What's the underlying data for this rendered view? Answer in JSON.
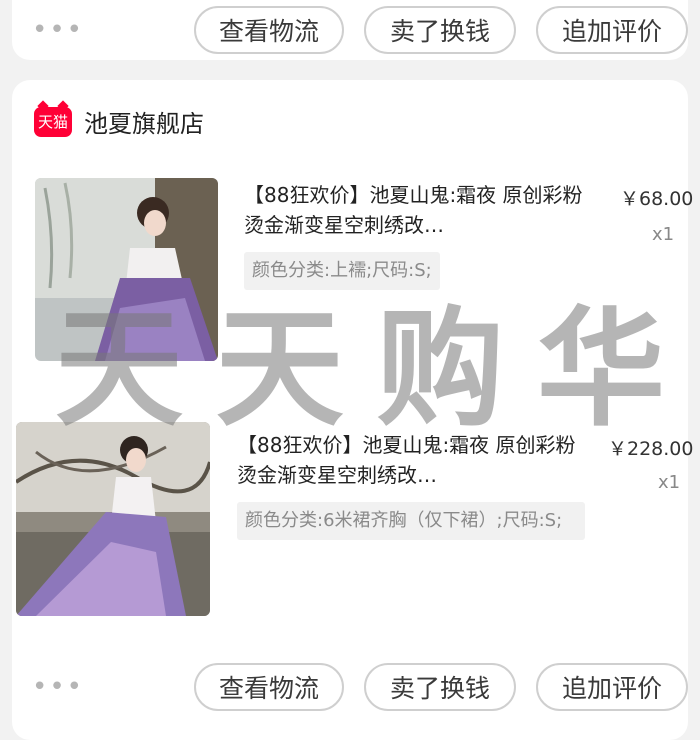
{
  "top_actions": {
    "more": "•••",
    "buttons": [
      "查看物流",
      "卖了换钱",
      "追加评价"
    ]
  },
  "shop": {
    "badge": "天猫",
    "name": "池夏旗舰店"
  },
  "items": [
    {
      "title": "【88狂欢价】池夏山鬼:霜夜 原创彩粉烫金渐变星空刺绣改…",
      "price": "￥68.00",
      "qty": "x1",
      "spec": "颜色分类:上襦;尺码:S;"
    },
    {
      "title": "【88狂欢价】池夏山鬼:霜夜 原创彩粉烫金渐变星空刺绣改…",
      "price": "￥228.00",
      "qty": "x1",
      "spec": "颜色分类:6米裙齐胸（仅下裙）;尺码:S;"
    }
  ],
  "bottom_actions": {
    "more": "•••",
    "buttons": [
      "查看物流",
      "卖了换钱",
      "追加评价"
    ]
  },
  "watermark": [
    "天",
    "天",
    "购",
    "华"
  ],
  "colors": {
    "brand": "#ff0036",
    "background": "#f2f2f2"
  }
}
